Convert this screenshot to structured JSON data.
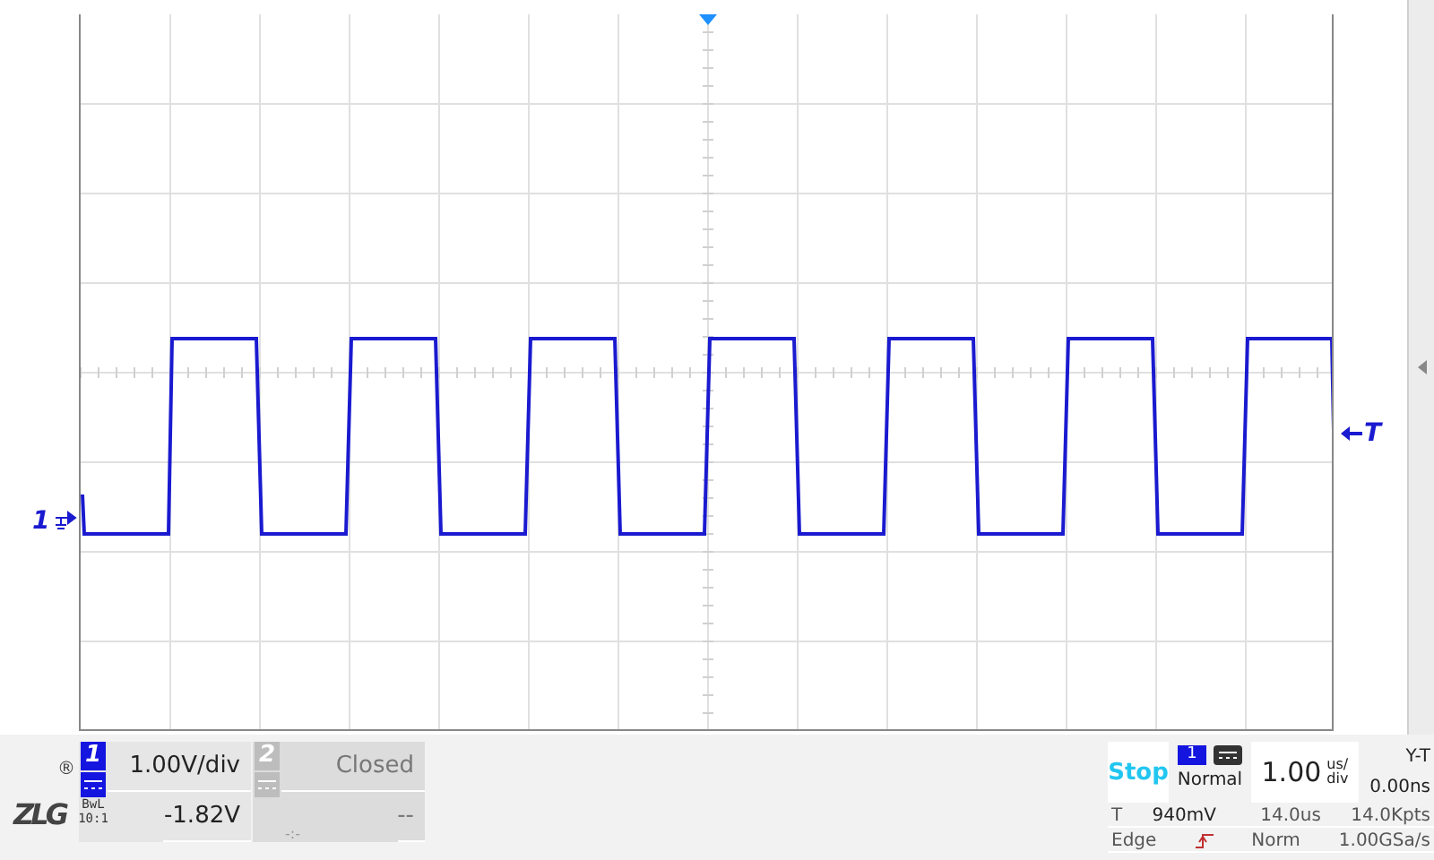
{
  "plot": {
    "trigger_position_marker": true,
    "channel_marker": "1",
    "trigger_level_marker": "T"
  },
  "logo": {
    "text": "ZLG",
    "mark": "®"
  },
  "channels": [
    {
      "number": "1",
      "enabled": true,
      "coupling_note": "BwL",
      "probe": "10:1",
      "scale": "1.00V/div",
      "offset": "-1.82V"
    },
    {
      "number": "2",
      "enabled": false,
      "scale": "Closed",
      "offset": "--",
      "offset_note": "-:-"
    }
  ],
  "acquisition": {
    "run_state": "Stop",
    "trigger_source": "1",
    "trigger_mode": "Normal",
    "timebase_value": "1.00",
    "timebase_unit_top": "us/",
    "timebase_unit_bottom": "div",
    "display_mode": "Y-T",
    "horizontal_position": "0.00ns",
    "trigger_label": "T",
    "trigger_level": "940mV",
    "record_time": "14.0us",
    "record_length": "14.0Kpts",
    "trigger_type": "Edge",
    "trigger_sweep": "Norm",
    "sample_rate": "1.00GSa/s"
  }
}
